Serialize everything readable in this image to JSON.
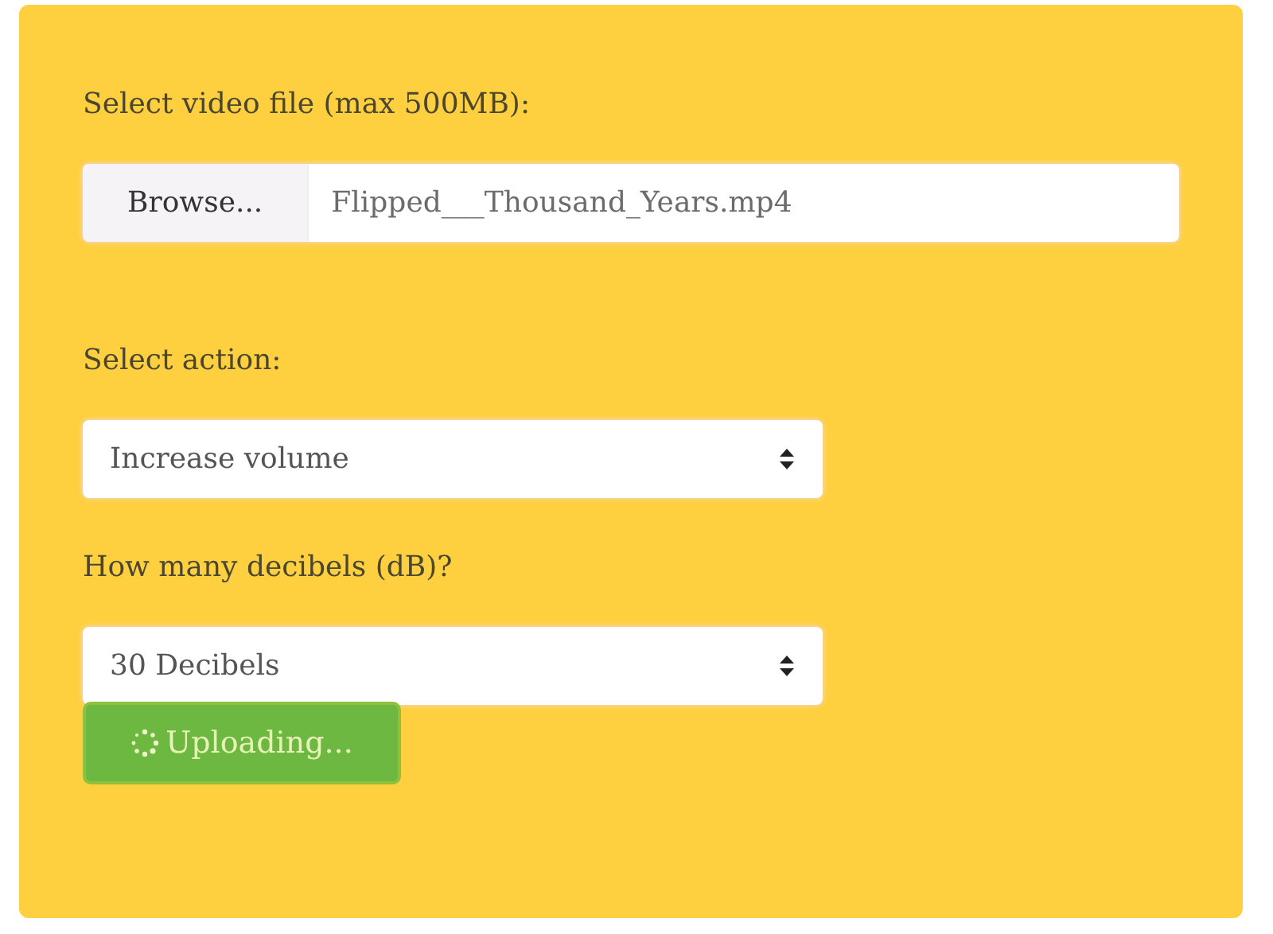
{
  "file_field": {
    "label": "Select video file (max 500MB):",
    "button": "Browse...",
    "value": "Flipped___Thousand_Years.mp4"
  },
  "action_field": {
    "label": "Select action:",
    "value": "Increase volume"
  },
  "decibels_field": {
    "label": "How many decibels (dB)?",
    "value": "30 Decibels"
  },
  "submit": {
    "label": "Uploading...",
    "loading": true
  }
}
